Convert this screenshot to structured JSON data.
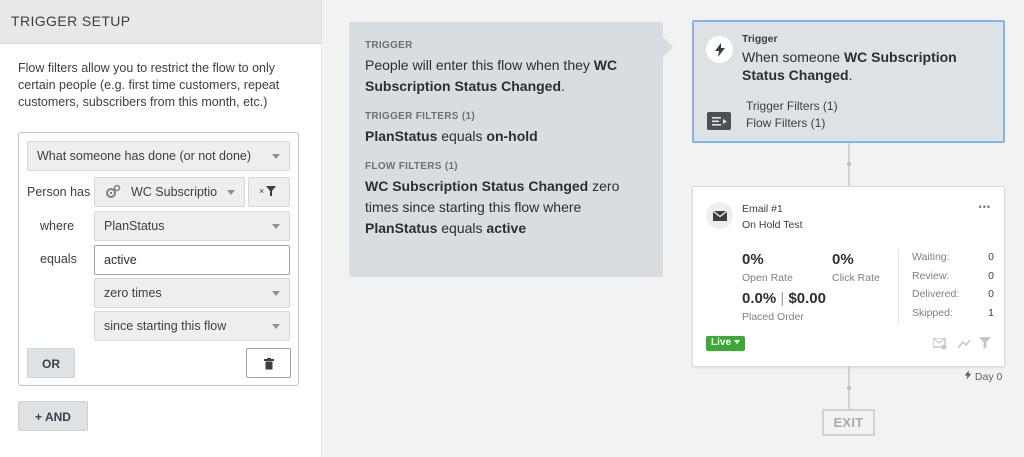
{
  "sidebar": {
    "title": "TRIGGER SETUP",
    "description": "Flow filters allow you to restrict the flow to only certain people (e.g. first time customers, repeat customers, subscribers from this month, etc.)",
    "filter": {
      "condition_type": "What someone has done (or not done)",
      "person_has_label": "Person has",
      "metric": "WC Subscriptio",
      "where_label": "where",
      "property": "PlanStatus",
      "equals_label": "equals",
      "value": "active",
      "frequency": "zero times",
      "timeframe": "since starting this flow",
      "or_label": "OR"
    },
    "and_label": "+ AND"
  },
  "info": {
    "trigger_label": "TRIGGER",
    "trigger_text_pre": "People will enter this flow when they ",
    "trigger_text_bold": "WC Subscription Status Changed",
    "trigger_text_post": ".",
    "trigger_filters_label": "TRIGGER FILTERS (1)",
    "tf_prop": "PlanStatus",
    "tf_op": " equals ",
    "tf_val": "on-hold",
    "flow_filters_label": "FLOW FILTERS (1)",
    "ff_metric": "WC Subscription Status Changed",
    "ff_mid": " zero times since starting this flow where ",
    "ff_prop": "PlanStatus",
    "ff_op": " equals ",
    "ff_val": "active"
  },
  "trigger_node": {
    "label": "Trigger",
    "text_pre": "When someone ",
    "text_bold": "WC Subscription Status Changed",
    "text_post": ".",
    "trigger_filters": "Trigger Filters (1)",
    "flow_filters": "Flow Filters (1)"
  },
  "email_node": {
    "title": "Email #1",
    "subtitle": "On Hold Test",
    "more": "•••",
    "open_rate_value": "0%",
    "open_rate_label": "Open Rate",
    "click_rate_value": "0%",
    "click_rate_label": "Click Rate",
    "placed_order_rate": "0.0%",
    "placed_order_sep": "|",
    "placed_order_value": "$0.00",
    "placed_order_label": "Placed Order",
    "counts": [
      {
        "label": "Waiting:",
        "value": "0"
      },
      {
        "label": "Review:",
        "value": "0"
      },
      {
        "label": "Delivered:",
        "value": "0"
      },
      {
        "label": "Skipped:",
        "value": "1"
      }
    ],
    "status": "Live",
    "delay": "Day 0"
  },
  "exit_label": "EXIT",
  "colors": {
    "accent_border": "#7fb6e3",
    "live_green": "#3aaa35"
  },
  "icons": [
    "lightning-icon",
    "list-icon",
    "envelope-icon",
    "gear-icon",
    "filter-icon",
    "trash-icon"
  ]
}
